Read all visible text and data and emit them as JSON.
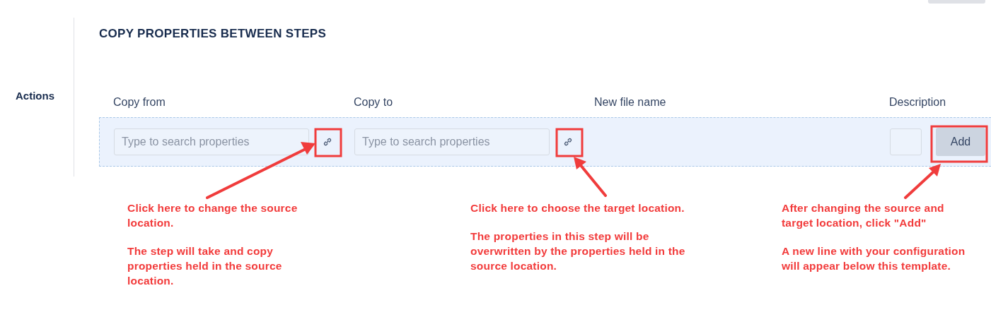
{
  "section_label": "Actions",
  "title": "COPY PROPERTIES BETWEEN STEPS",
  "columns": [
    "Copy from",
    "Copy to",
    "New file name",
    "Description"
  ],
  "row": {
    "copy_from": {
      "placeholder": "Type to search properties"
    },
    "copy_to": {
      "placeholder": "Type to search properties"
    },
    "add_button": "Add"
  },
  "notes": [
    {
      "paragraphs": [
        "Click here to change the source location.",
        "The step will take and copy properties held in the source location."
      ]
    },
    {
      "paragraphs": [
        "Click here to choose the target location.",
        "The properties in this step will be overwritten by the properties held in the source location."
      ]
    },
    {
      "paragraphs": [
        "After changing the source and target location, click \"Add\"",
        "A new line with your configuration will appear below this template."
      ]
    }
  ]
}
